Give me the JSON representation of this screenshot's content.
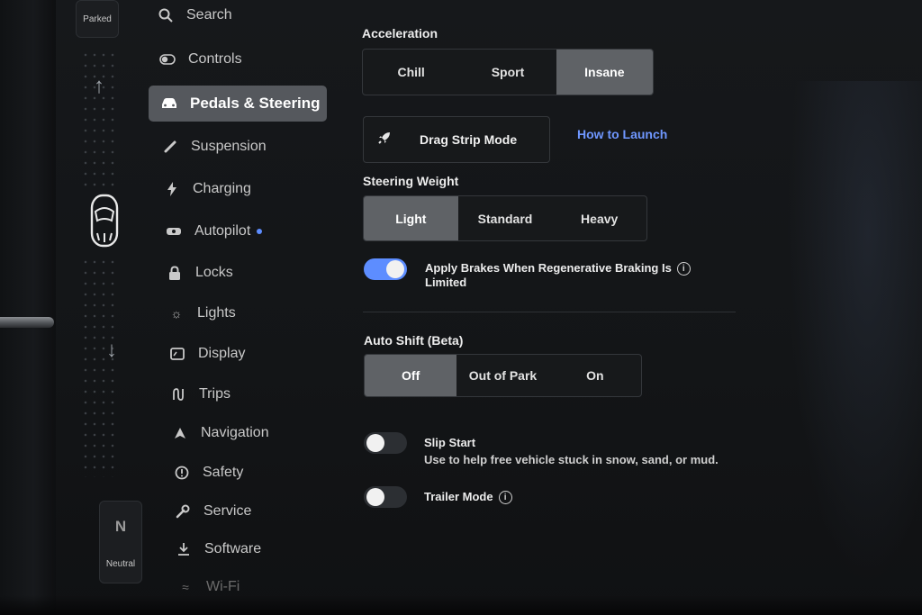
{
  "rail": {
    "top_gear": "Parked",
    "bottom_gear_letter": "N",
    "bottom_gear_label": "Neutral"
  },
  "menu": {
    "items": [
      {
        "label": "Search",
        "icon": "search-icon"
      },
      {
        "label": "Controls",
        "icon": "toggle-icon"
      },
      {
        "label": "Pedals & Steering",
        "icon": "car-icon",
        "active": true
      },
      {
        "label": "Suspension",
        "icon": "suspension-icon"
      },
      {
        "label": "Charging",
        "icon": "bolt-icon"
      },
      {
        "label": "Autopilot",
        "icon": "steering-icon",
        "badge_dot": true
      },
      {
        "label": "Locks",
        "icon": "lock-icon"
      },
      {
        "label": "Lights",
        "icon": "sun-icon"
      },
      {
        "label": "Display",
        "icon": "display-icon"
      },
      {
        "label": "Trips",
        "icon": "trips-icon"
      },
      {
        "label": "Navigation",
        "icon": "navigation-icon"
      },
      {
        "label": "Safety",
        "icon": "alert-icon"
      },
      {
        "label": "Service",
        "icon": "wrench-icon"
      },
      {
        "label": "Software",
        "icon": "download-icon"
      },
      {
        "label": "Wi-Fi",
        "icon": "wifi-icon"
      }
    ]
  },
  "acceleration": {
    "label": "Acceleration",
    "options": [
      "Chill",
      "Sport",
      "Insane"
    ],
    "selected": "Insane"
  },
  "drag_strip": {
    "label": "Drag Strip Mode",
    "link": "How to Launch"
  },
  "steering_weight": {
    "label": "Steering Weight",
    "options": [
      "Light",
      "Standard",
      "Heavy"
    ],
    "selected": "Light"
  },
  "apply_brakes": {
    "line1": "Apply Brakes When Regenerative Braking Is",
    "line2": "Limited",
    "enabled": true
  },
  "auto_shift": {
    "label": "Auto Shift (Beta)",
    "options": [
      "Off",
      "Out of Park",
      "On"
    ],
    "selected": "Off"
  },
  "slip_start": {
    "label": "Slip Start",
    "description": "Use to help free vehicle stuck in snow, sand, or mud.",
    "enabled": false
  },
  "trailer_mode": {
    "label": "Trailer Mode",
    "enabled": false
  },
  "colors": {
    "accent": "#5d8dff",
    "selected_segment": "#5f6266",
    "background": "#141618"
  }
}
